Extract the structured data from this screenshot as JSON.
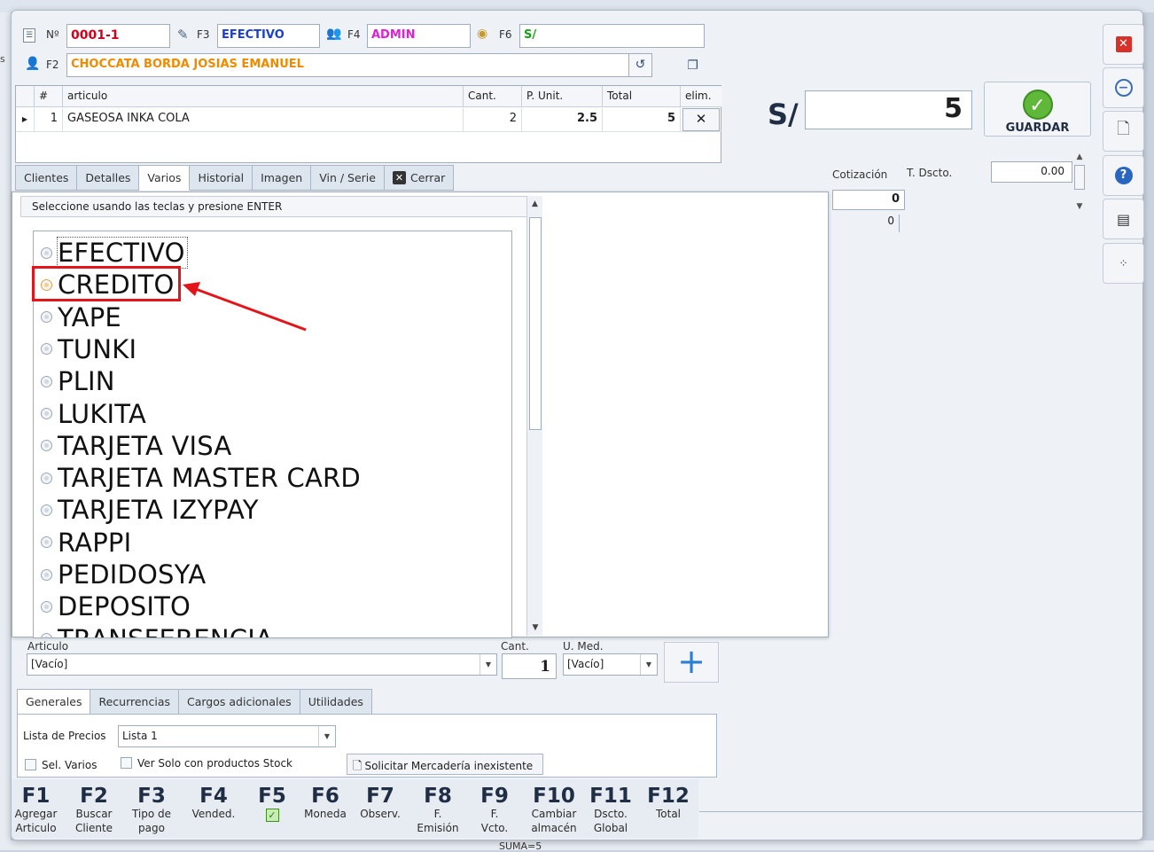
{
  "header": {
    "numero_label": "Nº",
    "numero_value": "0001-1",
    "f3_label": "F3",
    "tipo_pago": "EFECTIVO",
    "f4_label": "F4",
    "vendedor": "ADMIN",
    "f6_label": "F6",
    "moneda": "S/",
    "f2_label": "F2",
    "cliente": "CHOCCATA BORDA JOSIAS EMANUEL"
  },
  "table": {
    "columns": [
      "#",
      "articulo",
      "Cant.",
      "P. Unit.",
      "Total",
      "elim."
    ],
    "rows": [
      {
        "num": "1",
        "articulo": "GASEOSA INKA COLA",
        "cant": "2",
        "punit": "2.5",
        "total": "5",
        "elim": "✕"
      }
    ]
  },
  "total_panel": {
    "currency": "S/",
    "amount": "5",
    "save_label": "GUARDAR"
  },
  "right_info": {
    "cotizacion_label": "Cotización",
    "tdscto_label": "T. Dscto.",
    "tdscto_value": "0.00",
    "val1": "0",
    "val2": "0"
  },
  "tabs": [
    "Clientes",
    "Detalles",
    "Varios",
    "Historial",
    "Imagen",
    "Vin / Serie",
    "Cerrar"
  ],
  "popup": {
    "hint": "Seleccione usando las teclas y presione ENTER",
    "options": [
      "EFECTIVO",
      "CREDITO",
      "YAPE",
      "TUNKI",
      "PLIN",
      "LUKITA",
      "TARJETA VISA",
      "TARJETA MASTER CARD",
      "TARJETA IZYPAY",
      "RAPPI",
      "PEDIDOSYA",
      "DEPOSITO",
      "TRANSFERENCIA"
    ],
    "selected": "CREDITO"
  },
  "article_entry": {
    "articulo_label": "Articulo",
    "articulo_value": "[Vacío]",
    "cant_label": "Cant.",
    "cant_value": "1",
    "umed_label": "U. Med.",
    "umed_value": "[Vacío]"
  },
  "bottom_tabs": [
    "Generales",
    "Recurrencias",
    "Cargos adicionales",
    "Utilidades"
  ],
  "generales": {
    "lista_label": "Lista de Precios",
    "lista_value": "Lista 1",
    "sel_varios": "Sel. Varios",
    "ver_solo": "Ver Solo con productos Stock",
    "solicitar": "Solicitar Mercadería inexistente"
  },
  "fkeys": [
    {
      "key": "F1",
      "l1": "Agregar",
      "l2": "Articulo"
    },
    {
      "key": "F2",
      "l1": "Buscar",
      "l2": "Cliente"
    },
    {
      "key": "F3",
      "l1": "Tipo de",
      "l2": "pago"
    },
    {
      "key": "F4",
      "l1": "Vended.",
      "l2": ""
    },
    {
      "key": "F5",
      "l1": "",
      "l2": ""
    },
    {
      "key": "F6",
      "l1": "Moneda",
      "l2": ""
    },
    {
      "key": "F7",
      "l1": "Observ.",
      "l2": ""
    },
    {
      "key": "F8",
      "l1": "F.",
      "l2": "Emisión"
    },
    {
      "key": "F9",
      "l1": "F.",
      "l2": "Vcto."
    },
    {
      "key": "F10",
      "l1": "Cambiar",
      "l2": "almacén"
    },
    {
      "key": "F11",
      "l1": "Dscto.",
      "l2": "Global"
    },
    {
      "key": "F12",
      "l1": "Total",
      "l2": ""
    }
  ],
  "status_bottom": "SUMA=5",
  "colors": {
    "numero": "#d0021b",
    "tipo_pago": "#1a3fd6",
    "vendedor": "#e020d8",
    "moneda": "#17a31a",
    "cliente": "#f08a00",
    "highlight": "#e3151a"
  }
}
